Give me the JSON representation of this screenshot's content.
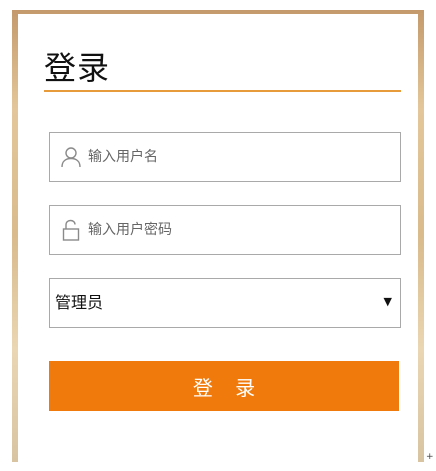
{
  "login": {
    "title": "登录",
    "username": {
      "placeholder": "输入用户名",
      "value": ""
    },
    "password": {
      "placeholder": "输入用户密码",
      "value": ""
    },
    "role_select": {
      "selected": "管理员"
    },
    "submit_label": "登 录"
  },
  "icons": {
    "username_icon": "user-icon",
    "password_icon": "unlock-icon",
    "select_icon": "chevron-down-icon"
  },
  "colors": {
    "accent": "#f07b0c",
    "title_rule": "#e89b3a",
    "frame": "#d9bb8c"
  },
  "corner_mark": "+"
}
